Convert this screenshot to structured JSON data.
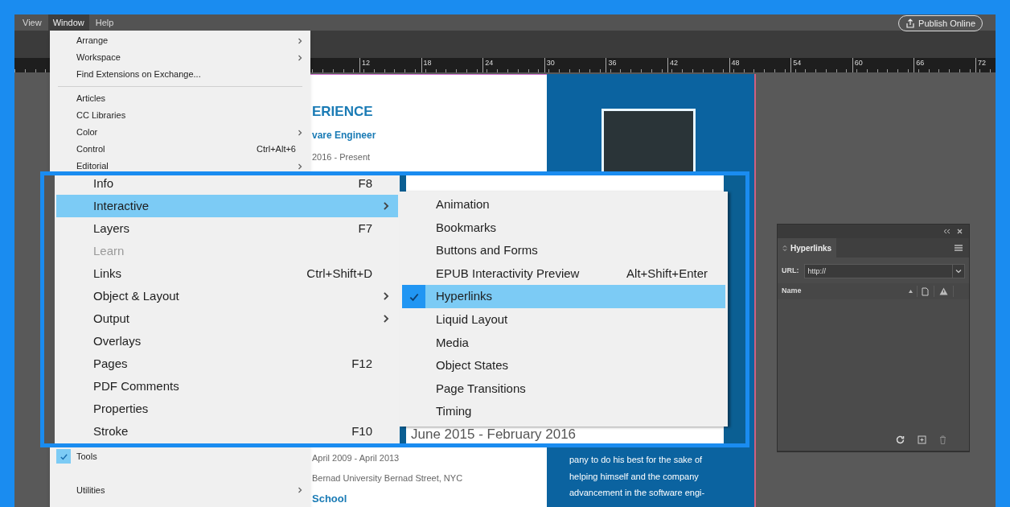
{
  "menu_bar": [
    {
      "label": "View",
      "selected": false
    },
    {
      "label": "Window",
      "selected": true
    },
    {
      "label": "Help",
      "selected": false
    }
  ],
  "publish_button": "Publish Online",
  "ruler_labels": [
    "12",
    "18",
    "24",
    "30",
    "36",
    "42",
    "48",
    "54",
    "60",
    "66",
    "72"
  ],
  "document": {
    "heading": "ERIENCE",
    "job_title": "vare Engineer",
    "job_dates": "2016 - Present",
    "school_dates": "April 2009 - April 2013",
    "school_address": "Bernad University Bernad Street, NYC",
    "school_heading": "School",
    "bio_lines": [
      "pany to do his best for the sake of",
      "helping himself and the company",
      "advancement in the software engi-"
    ]
  },
  "window_menu": {
    "groups": [
      [
        {
          "label": "Arrange",
          "submenu": true
        },
        {
          "label": "Workspace",
          "submenu": true
        },
        {
          "label": "Find Extensions on Exchange...",
          "submenu": false
        }
      ],
      [
        {
          "label": "Articles",
          "submenu": false
        },
        {
          "label": "CC Libraries",
          "submenu": false
        },
        {
          "label": "Color",
          "submenu": true
        },
        {
          "label": "Control",
          "shortcut": "Ctrl+Alt+6",
          "submenu": false
        },
        {
          "label": "Editorial",
          "submenu": true
        }
      ]
    ],
    "bottom_items": [
      {
        "label": "Tools",
        "checked": true,
        "submenu": false
      },
      {
        "label": "Utilities",
        "checked": false,
        "submenu": true
      }
    ]
  },
  "zoom_callout": {
    "menu_items": [
      {
        "label": "Info",
        "shortcut": "F8",
        "submenu": false,
        "selected": false,
        "disabled": false
      },
      {
        "label": "Interactive",
        "submenu": true,
        "selected": true,
        "disabled": false
      },
      {
        "label": "Layers",
        "shortcut": "F7",
        "submenu": false,
        "selected": false,
        "disabled": false
      },
      {
        "label": "Learn",
        "submenu": false,
        "selected": false,
        "disabled": true
      },
      {
        "label": "Links",
        "shortcut": "Ctrl+Shift+D",
        "submenu": false,
        "selected": false,
        "disabled": false
      },
      {
        "label": "Object & Layout",
        "submenu": true,
        "selected": false,
        "disabled": false
      },
      {
        "label": "Output",
        "submenu": true,
        "selected": false,
        "disabled": false
      },
      {
        "label": "Overlays",
        "submenu": false,
        "selected": false,
        "disabled": false
      },
      {
        "label": "Pages",
        "shortcut": "F12",
        "submenu": false,
        "selected": false,
        "disabled": false
      },
      {
        "label": "PDF Comments",
        "submenu": false,
        "selected": false,
        "disabled": false
      },
      {
        "label": "Properties",
        "submenu": false,
        "selected": false,
        "disabled": false
      },
      {
        "label": "Stroke",
        "shortcut": "F10",
        "submenu": false,
        "selected": false,
        "disabled": false
      }
    ],
    "submenu_items": [
      {
        "label": "Animation",
        "checked": false,
        "selected": false
      },
      {
        "label": "Bookmarks",
        "checked": false,
        "selected": false
      },
      {
        "label": "Buttons and Forms",
        "checked": false,
        "selected": false
      },
      {
        "label": "EPUB Interactivity Preview",
        "shortcut": "Alt+Shift+Enter",
        "checked": false,
        "selected": false
      },
      {
        "label": "Hyperlinks",
        "checked": true,
        "selected": true
      },
      {
        "label": "Liquid Layout",
        "checked": false,
        "selected": false
      },
      {
        "label": "Media",
        "checked": false,
        "selected": false
      },
      {
        "label": "Object States",
        "checked": false,
        "selected": false
      },
      {
        "label": "Page Transitions",
        "checked": false,
        "selected": false
      },
      {
        "label": "Timing",
        "checked": false,
        "selected": false
      }
    ],
    "background_text": "June 2015 - February 2016"
  },
  "hyperlinks_panel": {
    "tab": "Hyperlinks",
    "url_label": "URL:",
    "url_value": "http://",
    "column": "Name"
  }
}
